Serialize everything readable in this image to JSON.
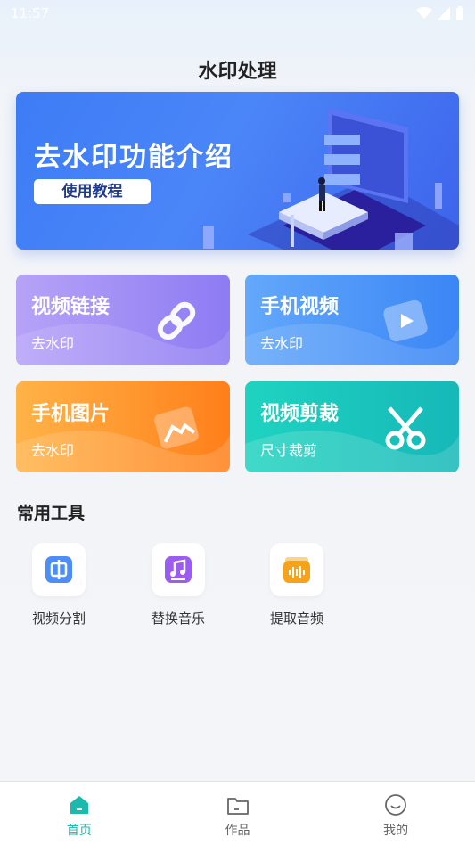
{
  "status_bar": {
    "time": "11:57"
  },
  "page_title": "水印处理",
  "banner": {
    "title": "去水印功能介绍",
    "button_label": "使用教程"
  },
  "cards": [
    {
      "title": "视频链接",
      "subtitle": "去水印",
      "icon": "link-icon"
    },
    {
      "title": "手机视频",
      "subtitle": "去水印",
      "icon": "video-play-icon"
    },
    {
      "title": "手机图片",
      "subtitle": "去水印",
      "icon": "image-icon"
    },
    {
      "title": "视频剪裁",
      "subtitle": "尺寸裁剪",
      "icon": "scissors-icon"
    }
  ],
  "tools": {
    "section_title": "常用工具",
    "items": [
      {
        "label": "视频分割",
        "icon": "split-icon",
        "color": "#4e8df7"
      },
      {
        "label": "替换音乐",
        "icon": "music-icon",
        "color": "#9b5cf0"
      },
      {
        "label": "提取音频",
        "icon": "audio-wave-icon",
        "color": "#f7a21b"
      }
    ]
  },
  "tabbar": {
    "items": [
      {
        "label": "首页",
        "icon": "home-icon",
        "active": true
      },
      {
        "label": "作品",
        "icon": "folder-icon",
        "active": false
      },
      {
        "label": "我的",
        "icon": "smile-icon",
        "active": false
      }
    ],
    "active_color": "#1cb9ac"
  }
}
